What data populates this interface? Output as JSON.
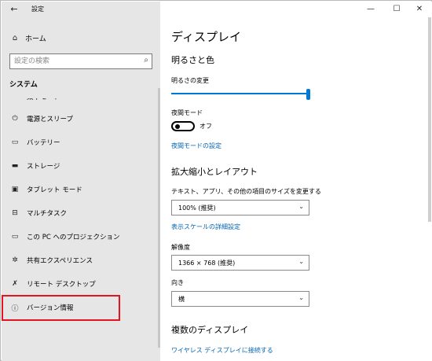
{
  "window": {
    "title": "設定",
    "back_icon": "arrow-left-icon",
    "controls": {
      "minimize": "—",
      "maximize": "☐",
      "close": "✕"
    }
  },
  "sidebar": {
    "home_label": "ホーム",
    "search_placeholder": "設定の検索",
    "section_title": "システム",
    "items": [
      {
        "label": "集中モード",
        "icon": "moon-icon"
      },
      {
        "label": "電源とスリープ",
        "icon": "power-icon"
      },
      {
        "label": "バッテリー",
        "icon": "battery-icon"
      },
      {
        "label": "ストレージ",
        "icon": "storage-icon"
      },
      {
        "label": "タブレット モード",
        "icon": "tablet-icon"
      },
      {
        "label": "マルチタスク",
        "icon": "multitask-icon"
      },
      {
        "label": "この PC へのプロジェクション",
        "icon": "projection-icon"
      },
      {
        "label": "共有エクスペリエンス",
        "icon": "share-icon"
      },
      {
        "label": "リモート デスクトップ",
        "icon": "remote-icon"
      },
      {
        "label": "バージョン情報",
        "icon": "info-icon"
      }
    ]
  },
  "main": {
    "title": "ディスプレイ",
    "brightness_section": "明るさと色",
    "brightness_label": "明るさの変更",
    "brightness_level": 1.0,
    "night_light_label": "夜間モード",
    "night_light_state": "オフ",
    "night_light_settings_link": "夜間モードの設定",
    "scale_section": "拡大縮小とレイアウト",
    "scale_label": "テキスト、アプリ、その他の項目のサイズを変更する",
    "scale_value": "100% (推奨)",
    "advanced_scale_link": "表示スケールの詳細設定",
    "resolution_label": "解像度",
    "resolution_value": "1366 × 768 (推奨)",
    "orientation_label": "向き",
    "orientation_value": "横",
    "multi_display_section": "複数のディスプレイ",
    "wireless_link": "ワイヤレス ディスプレイに接続する"
  },
  "colors": {
    "accent": "#0078d7",
    "link": "#0063b1",
    "highlight": "#e3141f",
    "sidebar_bg": "#e6e6e6"
  }
}
